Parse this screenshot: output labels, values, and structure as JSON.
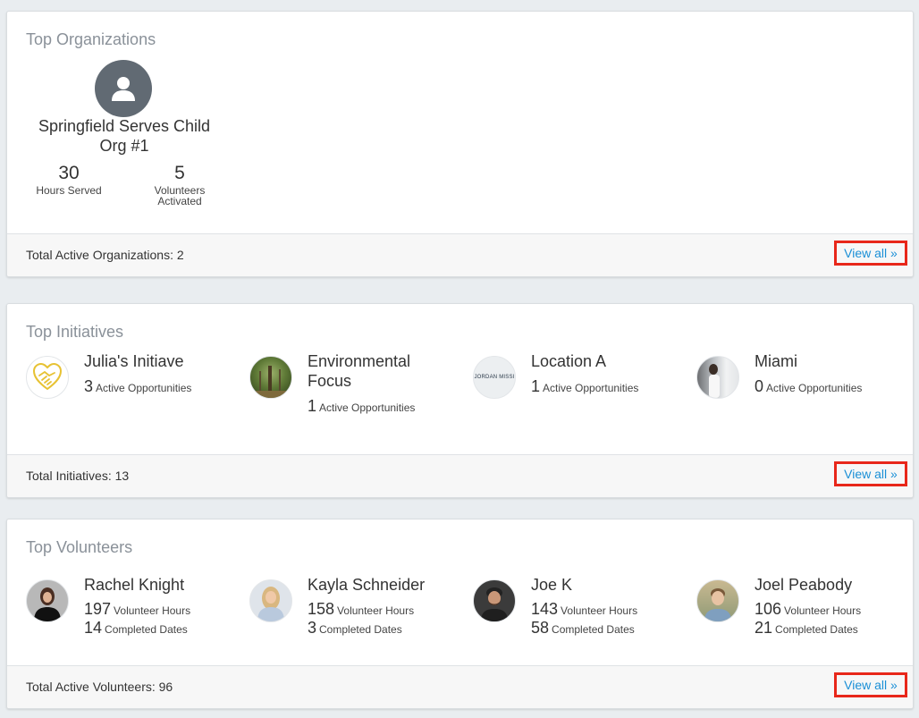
{
  "top_organizations": {
    "title": "Top Organizations",
    "org": {
      "name": "Springfield Serves Child Org #1",
      "hours": "30",
      "hours_label": "Hours Served",
      "volunteers": "5",
      "volunteers_label": "Volunteers Activated"
    },
    "footer_text": "Total Active Organizations: 2",
    "view_all": "View all »"
  },
  "top_initiatives": {
    "title": "Top Initiatives",
    "items": [
      {
        "name": "Julia's Initiave",
        "count": "3",
        "label": "Active Opportunities",
        "icon": "handshake-heart-icon"
      },
      {
        "name": "Environmental Focus",
        "count": "1",
        "label": "Active Opportunities",
        "icon": "forest-photo"
      },
      {
        "name": "Location A",
        "count": "1",
        "label": "Active Opportunities",
        "icon": "logo-text",
        "logo_text": "JORDAN MISSI"
      },
      {
        "name": "Miami",
        "count": "0",
        "label": "Active Opportunities",
        "icon": "photo"
      }
    ],
    "footer_text": "Total Initiatives: 13",
    "view_all": "View all »"
  },
  "top_volunteers": {
    "title": "Top Volunteers",
    "items": [
      {
        "name": "Rachel Knight",
        "hours": "197",
        "hours_label": "Volunteer Hours",
        "dates": "14",
        "dates_label": "Completed Dates"
      },
      {
        "name": "Kayla Schneider",
        "hours": "158",
        "hours_label": "Volunteer Hours",
        "dates": "3",
        "dates_label": "Completed Dates"
      },
      {
        "name": "Joe K",
        "hours": "143",
        "hours_label": "Volunteer Hours",
        "dates": "58",
        "dates_label": "Completed Dates"
      },
      {
        "name": "Joel Peabody",
        "hours": "106",
        "hours_label": "Volunteer Hours",
        "dates": "21",
        "dates_label": "Completed Dates"
      }
    ],
    "footer_text": "Total Active Volunteers: 96",
    "view_all": "View all »"
  },
  "colors": {
    "accent_link": "#1a8fd6",
    "highlight_border": "#e8271a",
    "avatar_gray": "#616a73"
  }
}
